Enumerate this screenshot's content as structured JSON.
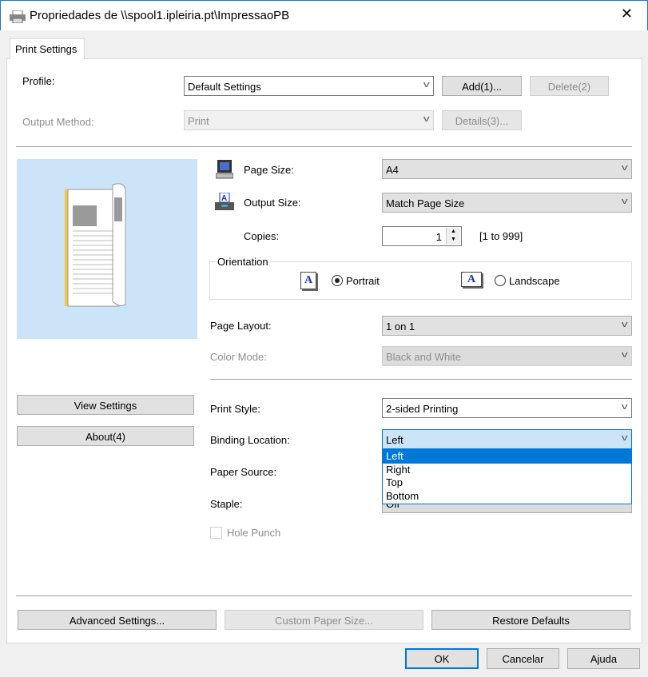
{
  "window": {
    "title": "Propriedades de \\\\spool1.ipleiria.pt\\ImpressaoPB",
    "close": "✕"
  },
  "tab": "Print Settings",
  "profile": {
    "label": "Profile:",
    "value": "Default Settings",
    "add": "Add(1)...",
    "delete": "Delete(2)"
  },
  "output_method": {
    "label": "Output Method:",
    "value": "Print",
    "details": "Details(3)..."
  },
  "left": {
    "view_settings": "View Settings",
    "about": "About(4)"
  },
  "page_size": {
    "label": "Page Size:",
    "value": "A4"
  },
  "output_size": {
    "label": "Output Size:",
    "value": "Match Page Size"
  },
  "copies": {
    "label": "Copies:",
    "value": "1",
    "range": "[1 to 999]"
  },
  "orientation": {
    "label": "Orientation",
    "portrait": "Portrait",
    "landscape": "Landscape",
    "icon_letter": "A",
    "selected": "Portrait"
  },
  "page_layout": {
    "label": "Page Layout:",
    "value": "1 on 1"
  },
  "color_mode": {
    "label": "Color Mode:",
    "value": "Black and White"
  },
  "print_style": {
    "label": "Print Style:",
    "value": "2-sided Printing"
  },
  "binding": {
    "label": "Binding Location:",
    "value": "Left",
    "options": [
      "Left",
      "Right",
      "Top",
      "Bottom"
    ]
  },
  "paper_source": {
    "label": "Paper Source:"
  },
  "staple": {
    "label": "Staple:",
    "value": "Off"
  },
  "hole_punch": {
    "label": "Hole Punch",
    "checked": false
  },
  "bottom": {
    "advanced": "Advanced Settings...",
    "custom": "Custom Paper Size...",
    "restore": "Restore Defaults"
  },
  "dialog": {
    "ok": "OK",
    "cancel": "Cancelar",
    "help": "Ajuda"
  },
  "colors": {
    "accent": "#0078d7",
    "preview_bg": "#cce4f7",
    "focus_bg": "#cce4f7"
  }
}
